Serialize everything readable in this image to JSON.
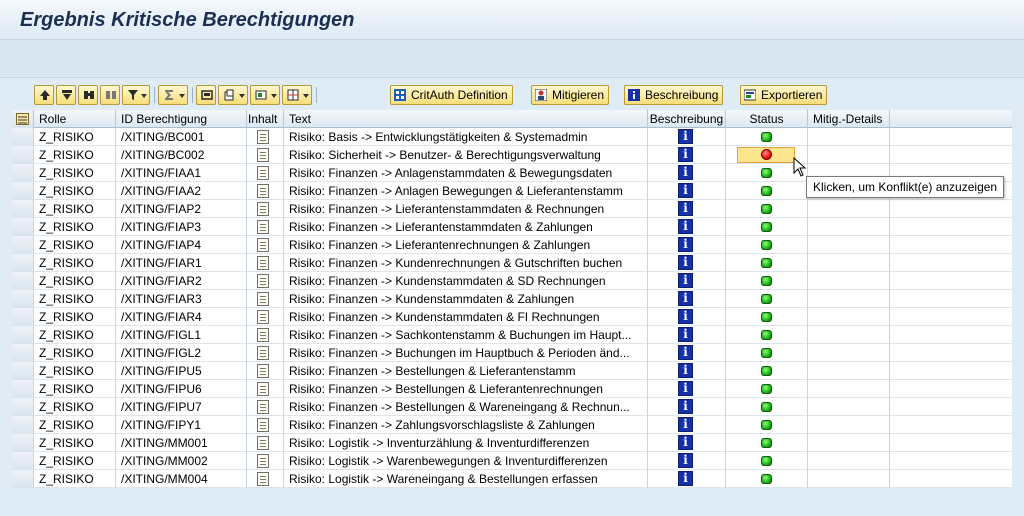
{
  "title": "Ergebnis Kritische Berechtigungen",
  "toolbar": {
    "icons": [
      "up-arrow-icon",
      "filter-row-icon",
      "find-icon",
      "find-next-icon",
      "filter-icon",
      "sum-icon",
      "print-icon",
      "export-icon",
      "layout-icon",
      "columns-icon"
    ],
    "critauth_label": "CritAuth Definition",
    "mitigieren_label": "Mitigieren",
    "beschreibung_label": "Beschreibung",
    "exportieren_label": "Exportieren"
  },
  "columns": {
    "rolle": "Rolle",
    "id": "ID Berechtigung",
    "inhalt": "Inhalt",
    "text": "Text",
    "beschreibung": "Beschreibung",
    "status": "Status",
    "mitig": "Mitig.-Details"
  },
  "rows": [
    {
      "rolle": "Z_RISIKO",
      "id": "/XITING/BC001",
      "text": "Risiko: Basis -> Entwicklungstätigkeiten & Systemadmin",
      "status": "green"
    },
    {
      "rolle": "Z_RISIKO",
      "id": "/XITING/BC002",
      "text": "Risiko: Sicherheit -> Benutzer- & Berechtigungsverwaltung",
      "status": "red"
    },
    {
      "rolle": "Z_RISIKO",
      "id": "/XITING/FIAA1",
      "text": "Risiko: Finanzen -> Anlagenstammdaten & Bewegungsdaten",
      "status": "green"
    },
    {
      "rolle": "Z_RISIKO",
      "id": "/XITING/FIAA2",
      "text": "Risiko: Finanzen -> Anlagen Bewegungen & Lieferantenstamm",
      "status": "green"
    },
    {
      "rolle": "Z_RISIKO",
      "id": "/XITING/FIAP2",
      "text": "Risiko: Finanzen -> Lieferantenstammdaten & Rechnungen",
      "status": "green"
    },
    {
      "rolle": "Z_RISIKO",
      "id": "/XITING/FIAP3",
      "text": "Risiko: Finanzen -> Lieferantenstammdaten & Zahlungen",
      "status": "green"
    },
    {
      "rolle": "Z_RISIKO",
      "id": "/XITING/FIAP4",
      "text": "Risiko: Finanzen -> Lieferantenrechnungen & Zahlungen",
      "status": "green"
    },
    {
      "rolle": "Z_RISIKO",
      "id": "/XITING/FIAR1",
      "text": "Risiko: Finanzen -> Kundenrechnungen & Gutschriften buchen",
      "status": "green"
    },
    {
      "rolle": "Z_RISIKO",
      "id": "/XITING/FIAR2",
      "text": "Risiko: Finanzen -> Kundenstammdaten & SD Rechnungen",
      "status": "green"
    },
    {
      "rolle": "Z_RISIKO",
      "id": "/XITING/FIAR3",
      "text": "Risiko: Finanzen -> Kundenstammdaten & Zahlungen",
      "status": "green"
    },
    {
      "rolle": "Z_RISIKO",
      "id": "/XITING/FIAR4",
      "text": "Risiko: Finanzen -> Kundenstammdaten & FI Rechnungen",
      "status": "green"
    },
    {
      "rolle": "Z_RISIKO",
      "id": "/XITING/FIGL1",
      "text": "Risiko: Finanzen -> Sachkontenstamm & Buchungen im Haupt...",
      "status": "green"
    },
    {
      "rolle": "Z_RISIKO",
      "id": "/XITING/FIGL2",
      "text": "Risiko: Finanzen -> Buchungen im Hauptbuch & Perioden änd...",
      "status": "green"
    },
    {
      "rolle": "Z_RISIKO",
      "id": "/XITING/FIPU5",
      "text": "Risiko: Finanzen -> Bestellungen & Lieferantenstamm",
      "status": "green"
    },
    {
      "rolle": "Z_RISIKO",
      "id": "/XITING/FIPU6",
      "text": "Risiko: Finanzen -> Bestellungen & Lieferantenrechnungen",
      "status": "green"
    },
    {
      "rolle": "Z_RISIKO",
      "id": "/XITING/FIPU7",
      "text": "Risiko: Finanzen -> Bestellungen & Wareneingang & Rechnun...",
      "status": "green"
    },
    {
      "rolle": "Z_RISIKO",
      "id": "/XITING/FIPY1",
      "text": "Risiko: Finanzen -> Zahlungsvorschlagsliste & Zahlungen",
      "status": "green"
    },
    {
      "rolle": "Z_RISIKO",
      "id": "/XITING/MM001",
      "text": "Risiko: Logistik -> Inventurzählung & Inventurdifferenzen",
      "status": "green"
    },
    {
      "rolle": "Z_RISIKO",
      "id": "/XITING/MM002",
      "text": "Risiko: Logistik -> Warenbewegungen & Inventurdifferenzen",
      "status": "green"
    },
    {
      "rolle": "Z_RISIKO",
      "id": "/XITING/MM004",
      "text": "Risiko: Logistik -> Wareneingang & Bestellungen erfassen",
      "status": "green"
    }
  ],
  "tooltip": "Klicken, um Konflikt(e) anzuzeigen",
  "colors": {
    "status_green": "#21b21e",
    "status_red": "#e11111",
    "info_blue": "#1530a8",
    "highlight": "#fbe68e"
  }
}
